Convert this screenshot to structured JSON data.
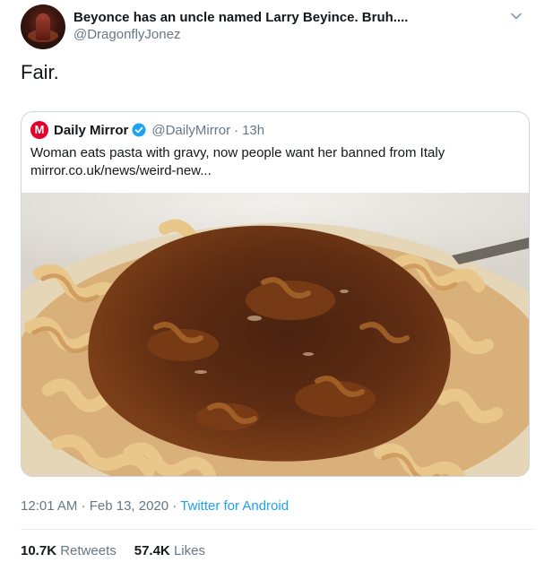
{
  "author": {
    "display_name": "Beyonce has an uncle named Larry Beyince. Bruh....",
    "handle": "@DragonflyJonez"
  },
  "tweet": {
    "text": "Fair."
  },
  "quoted": {
    "logo_letter": "M",
    "name": "Daily Mirror",
    "handle": "@DailyMirror",
    "separator": "·",
    "time": "13h",
    "text_line1": "Woman eats pasta with gravy, now people want her banned from Italy",
    "text_line2": "mirror.co.uk/news/weird-new..."
  },
  "meta": {
    "timestamp": "12:01 AM · Feb 13, 2020 · ",
    "source": "Twitter for Android"
  },
  "stats": {
    "retweets_count": "10.7K",
    "retweets_label": "Retweets",
    "likes_count": "57.4K",
    "likes_label": "Likes"
  },
  "colors": {
    "accent": "#1da1f2",
    "muted": "#657786",
    "text": "#14171a",
    "border": "#ccd6dd",
    "mirror_red": "#e4002b"
  },
  "icons": {
    "chevron": "chevron-down-icon",
    "verified": "verified-badge-icon"
  }
}
